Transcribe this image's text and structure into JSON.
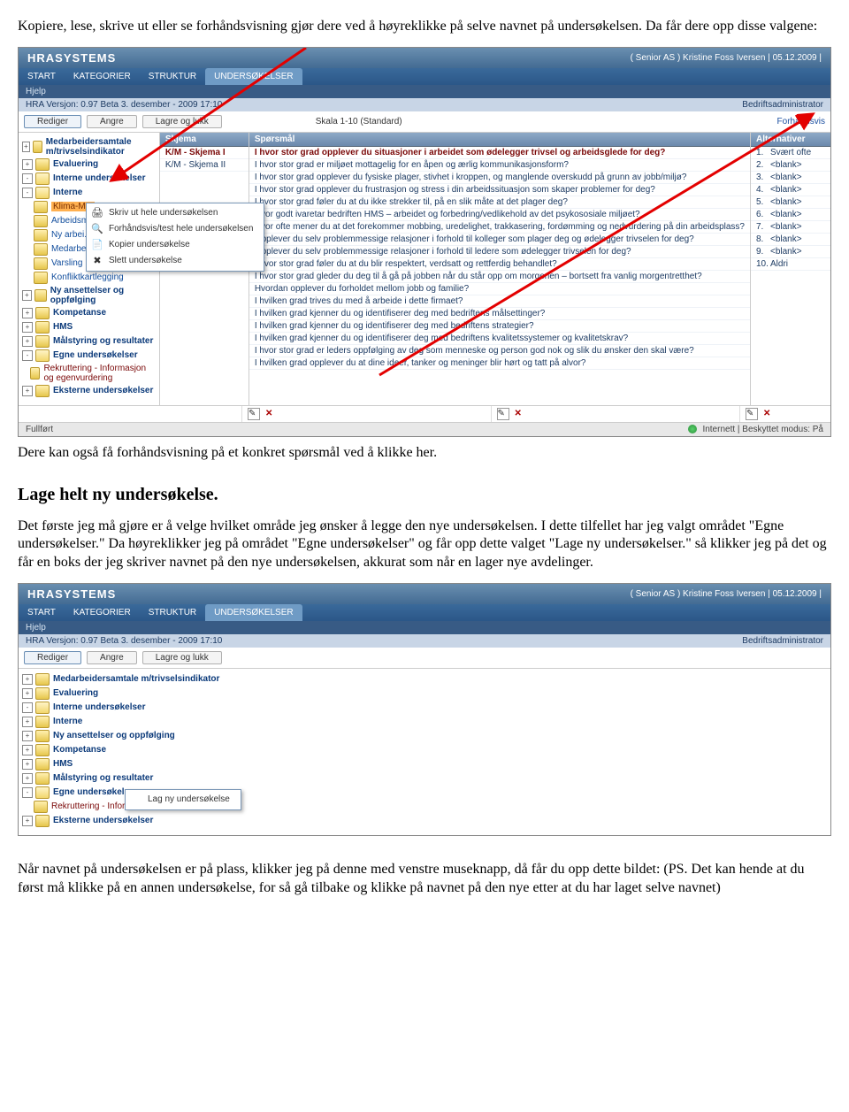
{
  "para1": "Kopiere, lese, skrive ut eller se forhåndsvisning gjør dere ved å høyreklikke på selve navnet på undersøkelsen. Da får dere opp disse valgene:",
  "para2": "Dere kan også få forhåndsvisning på et konkret spørsmål ved å klikke her.",
  "heading1": "Lage helt ny undersøkelse.",
  "para3": "Det første jeg må gjøre er å velge hvilket område jeg ønsker å legge den nye undersøkelsen. I dette tilfellet har jeg valgt området \"Egne undersøkelser.\" Da høyreklikker jeg på området \"Egne undersøkelser\" og får opp dette valget \"Lage ny undersøkelser.\" så klikker jeg på det og får en boks der jeg skriver navnet på den nye undersøkelsen, akkurat som når en lager nye avdelinger.",
  "para4": "Når navnet på undersøkelsen er på plass, klikker jeg på denne med venstre museknapp, då får du opp dette bildet: (PS. Det kan hende at du først må klikke på en annen undersøkelse, for så gå tilbake og klikke på navnet på den nye etter at du har laget selve navnet)",
  "app": {
    "logo": "HRASYSTEMS",
    "userinfo": "( Senior AS ) Kristine Foss Iversen | 05.12.2009 |",
    "menu": [
      "START",
      "KATEGORIER",
      "STRUKTUR",
      "UNDERSØKELSER"
    ],
    "help": "Hjelp",
    "version": "HRA Versjon: 0.97 Beta 3. desember - 2009 17:10",
    "role": "Bedriftsadministrator",
    "btn_rediger": "Rediger",
    "btn_angre": "Angre",
    "btn_lagre": "Lagre og lukk",
    "scale": "Skala 1-10 (Standard)",
    "preview": "Forhåndsvis",
    "tree1": [
      {
        "t": "+",
        "lbl": "Medarbeidersamtale m/trivselsindikator",
        "cls": "bold"
      },
      {
        "t": "+",
        "lbl": "Evaluering",
        "cls": "bold"
      },
      {
        "t": "-",
        "lbl": "Interne undersøkelser",
        "cls": "bold"
      },
      {
        "t": "-",
        "lbl": "Interne",
        "cls": "bold",
        "ind": 1
      },
      {
        "t": "",
        "lbl": "Klima-M...",
        "cls": "sel",
        "ind": 2
      },
      {
        "t": "",
        "lbl": "Arbeidsm...",
        "ind": 2
      },
      {
        "t": "",
        "lbl": "Ny arbei...",
        "ind": 2
      },
      {
        "t": "",
        "lbl": "Medarbe...",
        "ind": 2
      },
      {
        "t": "",
        "lbl": "Varsling",
        "ind": 2
      },
      {
        "t": "",
        "lbl": "Konfliktkartlegging",
        "ind": 2
      },
      {
        "t": "+",
        "lbl": "Ny ansettelser og oppfølging",
        "cls": "bold",
        "ind": 1
      },
      {
        "t": "+",
        "lbl": "Kompetanse",
        "cls": "bold",
        "ind": 1
      },
      {
        "t": "+",
        "lbl": "HMS",
        "cls": "bold",
        "ind": 1
      },
      {
        "t": "+",
        "lbl": "Målstyring og resultater",
        "cls": "bold",
        "ind": 1
      },
      {
        "t": "-",
        "lbl": "Egne undersøkelser",
        "cls": "bold",
        "ind": 1
      },
      {
        "t": "",
        "lbl": "Rekruttering - Informasjon og egenvurdering",
        "cls": "muted",
        "ind": 2
      },
      {
        "t": "+",
        "lbl": "Eksterne undersøkelser",
        "cls": "bold"
      }
    ],
    "ctx_menu1": [
      {
        "icon": "🖨",
        "lbl": "Skriv ut hele undersøkelsen"
      },
      {
        "icon": "🔍",
        "lbl": "Forhåndsvis/test hele undersøkelsen"
      },
      {
        "icon": "📄",
        "lbl": "Kopier undersøkelse"
      },
      {
        "icon": "✖",
        "lbl": "Slett undersøkelse"
      }
    ],
    "col_skjema": "Skjema",
    "col_sporsmal": "Spørsmål",
    "col_alt": "Alternativer",
    "skjema_rows": [
      "K/M - Skjema I",
      "K/M - Skjema II"
    ],
    "sporsmal_rows": [
      "I hvor stor grad opplever du situasjoner i arbeidet som ødelegger trivsel og arbeidsglede for deg?",
      "I hvor stor grad er miljøet mottagelig for en åpen og ærlig kommunikasjonsform?",
      "I hvor stor grad opplever du fysiske plager, stivhet i kroppen, og manglende overskudd på grunn av jobb/miljø?",
      "I hvor stor grad opplever du frustrasjon og stress i din arbeidssituasjon som skaper problemer for deg?",
      "I hvor stor grad føler du at du ikke strekker til, på en slik måte at det plager deg?",
      "Hvor godt ivaretar bedriften HMS – arbeidet og forbedring/vedlikehold av det psykososiale miljøet?",
      "Hvor ofte mener du at det forekommer mobbing, uredelighet, trakkasering, fordømming og nedvurdering på din arbeidsplass?",
      "Opplever du selv problemmessige relasjoner i forhold til kolleger som plager deg og ødelegger trivselen for deg?",
      "Opplever du selv problemmessige relasjoner i forhold til ledere som ødelegger trivselen for deg?",
      "I hvor stor grad føler du at du blir respektert, verdsatt og rettferdig behandlet?",
      "I hvor stor grad gleder du deg til å gå på jobben når du står opp om morgenen – bortsett fra vanlig morgentretthet?",
      "Hvordan opplever du forholdet mellom jobb og familie?",
      "I hvilken grad trives du med å arbeide i dette firmaet?",
      "I hvilken grad kjenner du og identifiserer deg med bedriftens målsettinger?",
      "I hvilken grad kjenner du og identifiserer deg med bedriftens strategier?",
      "I hvilken grad kjenner du og identifiserer deg med bedriftens kvalitetssystemer og kvalitetskrav?",
      "I hvor stor grad er leders oppfølging av deg som menneske og person god nok og slik du ønsker den skal være?",
      "I hvilken grad opplever du at dine ideer, tanker og meninger blir hørt og tatt på alvor?"
    ],
    "alt_rows": [
      {
        "n": "1.",
        "v": "Svært ofte"
      },
      {
        "n": "2.",
        "v": "<blank>"
      },
      {
        "n": "3.",
        "v": "<blank>"
      },
      {
        "n": "4.",
        "v": "<blank>"
      },
      {
        "n": "5.",
        "v": "<blank>"
      },
      {
        "n": "6.",
        "v": "<blank>"
      },
      {
        "n": "7.",
        "v": "<blank>"
      },
      {
        "n": "8.",
        "v": "<blank>"
      },
      {
        "n": "9.",
        "v": "<blank>"
      },
      {
        "n": "10.",
        "v": "Aldri"
      }
    ],
    "status_left": "Fullført",
    "status_right": "Internett | Beskyttet modus: På",
    "tree2": [
      {
        "t": "+",
        "lbl": "Medarbeidersamtale m/trivselsindikator",
        "cls": "bold"
      },
      {
        "t": "+",
        "lbl": "Evaluering",
        "cls": "bold"
      },
      {
        "t": "-",
        "lbl": "Interne undersøkelser",
        "cls": "bold"
      },
      {
        "t": "+",
        "lbl": "Interne",
        "cls": "bold",
        "ind": 1
      },
      {
        "t": "+",
        "lbl": "Ny ansettelser og oppfølging",
        "cls": "bold",
        "ind": 1
      },
      {
        "t": "+",
        "lbl": "Kompetanse",
        "cls": "bold",
        "ind": 1
      },
      {
        "t": "+",
        "lbl": "HMS",
        "cls": "bold",
        "ind": 1
      },
      {
        "t": "+",
        "lbl": "Målstyring og resultater",
        "cls": "bold",
        "ind": 1
      },
      {
        "t": "-",
        "lbl": "Egne undersøkelser",
        "cls": "bold",
        "ind": 1
      },
      {
        "t": "",
        "lbl": "Rekruttering - Informasjon og egenvurdering",
        "cls": "muted",
        "ind": 2
      },
      {
        "t": "+",
        "lbl": "Eksterne undersøkelser",
        "cls": "bold"
      }
    ],
    "ctx_menu2": [
      {
        "icon": "",
        "lbl": "Lag ny undersøkelse"
      }
    ]
  }
}
